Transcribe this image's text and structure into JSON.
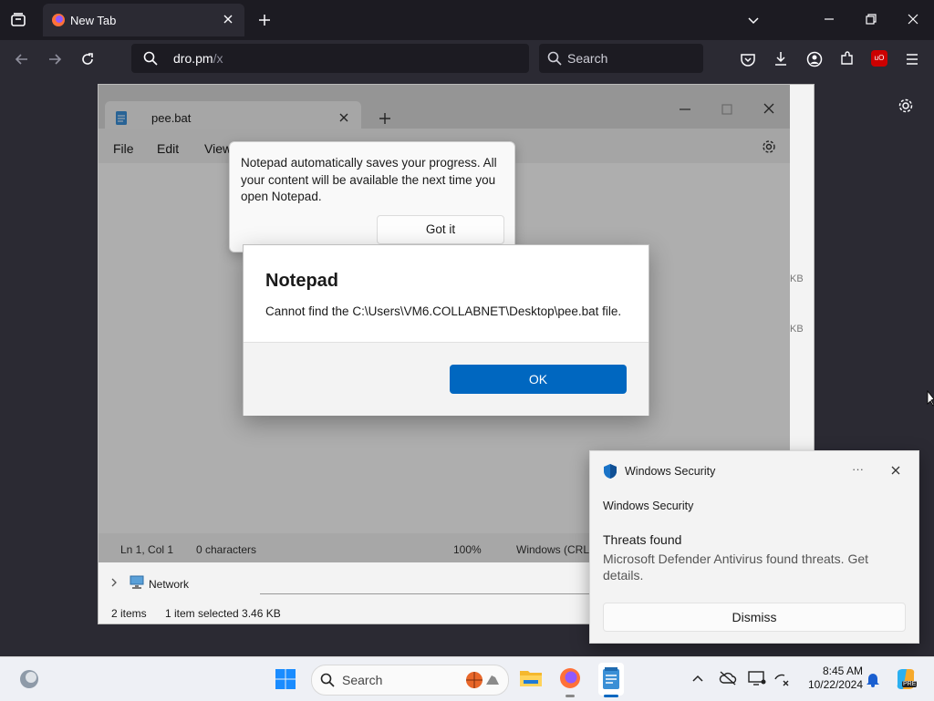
{
  "browser": {
    "tab_title": "New Tab",
    "url_main": "dro.pm",
    "url_rest": "/x",
    "search_placeholder": "Search",
    "ublock_label": "uO"
  },
  "notepad": {
    "tab_title": "pee.bat",
    "menu": [
      "File",
      "Edit",
      "View"
    ],
    "status": {
      "position": "Ln 1, Col 1",
      "chars": "0 characters",
      "zoom": "100%",
      "line_endings": "Windows (CRL"
    }
  },
  "tip": {
    "message": "Notepad automatically saves your progress. All your content will be available the next time you open Notepad.",
    "button": "Got it"
  },
  "dialog": {
    "title": "Notepad",
    "message": "Cannot find the C:\\Users\\VM6.COLLABNET\\Desktop\\pee.bat file.",
    "ok": "OK"
  },
  "explorer": {
    "network": "Network",
    "items": "2 items",
    "selected": "1 item selected  3.46 KB",
    "kb1": "KB",
    "kb2": "KB"
  },
  "toast": {
    "app_name": "Windows Security",
    "sender": "Windows Security",
    "heading": "Threats found",
    "body": "Microsoft Defender Antivirus found threats. Get details.",
    "more": "···",
    "dismiss": "Dismiss"
  },
  "taskbar": {
    "search_placeholder": "Search",
    "time": "8:45 AM",
    "date": "10/22/2024",
    "copilot_badge": "PRE"
  },
  "colors": {
    "accent": "#0067c0",
    "browser_dark": "#1c1b22",
    "firefox_orange": "#ff7139"
  }
}
